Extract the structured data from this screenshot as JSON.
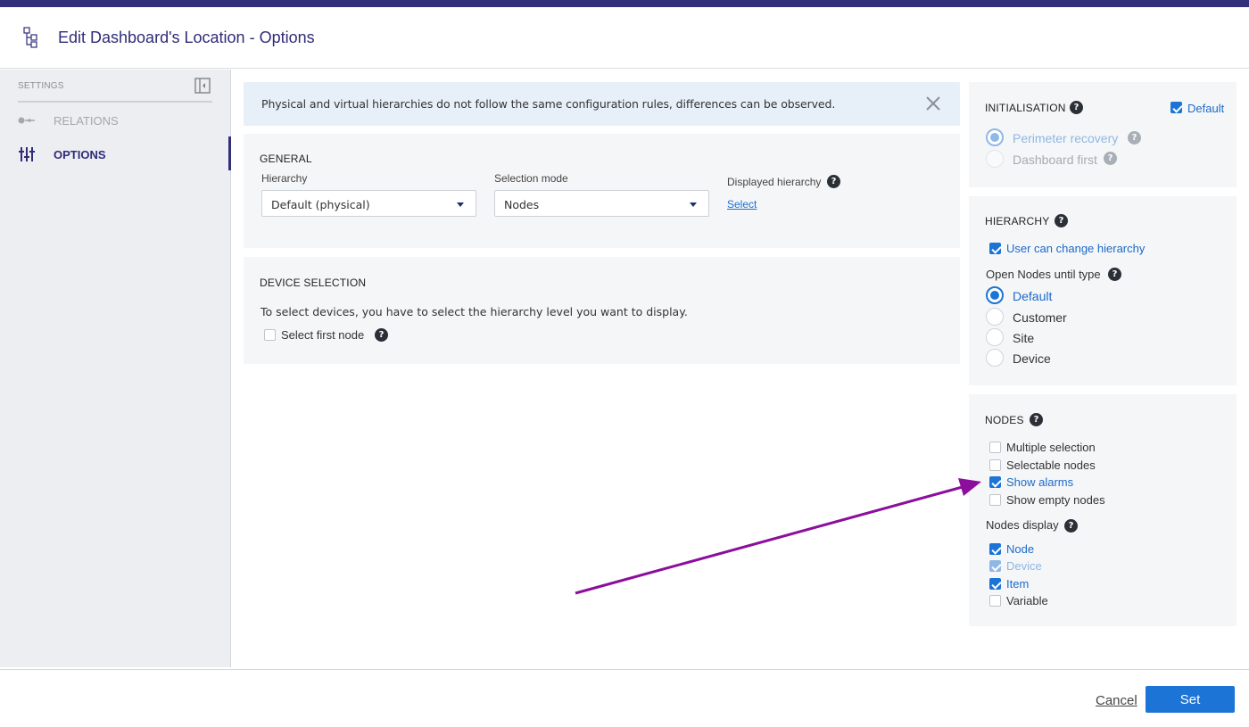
{
  "header": {
    "title": "Edit Dashboard's Location - Options",
    "icon": "hierarchy-tree-icon"
  },
  "sidebar": {
    "section_label": "SETTINGS",
    "items": [
      {
        "label": "RELATIONS",
        "icon": "relations-icon",
        "active": false
      },
      {
        "label": "OPTIONS",
        "icon": "sliders-icon",
        "active": true
      }
    ]
  },
  "notice": {
    "text": "Physical and virtual hierarchies do not follow the same configuration rules, differences can be observed."
  },
  "general": {
    "title": "GENERAL",
    "hierarchy_label": "Hierarchy",
    "hierarchy_value": "Default (physical)",
    "selection_mode_label": "Selection mode",
    "selection_mode_value": "Nodes",
    "displayed_hierarchy_label": "Displayed hierarchy",
    "select_link": "Select"
  },
  "device_selection": {
    "title": "DEVICE SELECTION",
    "description": "To select devices, you have to select the hierarchy level you want to display.",
    "select_first_node_label": "Select first node",
    "select_first_node_checked": false
  },
  "initialisation": {
    "title": "INITIALISATION",
    "default_label": "Default",
    "default_checked": true,
    "options": [
      {
        "label": "Perimeter recovery",
        "selected": true
      },
      {
        "label": "Dashboard first",
        "selected": false
      }
    ]
  },
  "hierarchy_panel": {
    "title": "HIERARCHY",
    "user_can_change_label": "User can change hierarchy",
    "user_can_change_checked": true,
    "open_nodes_label": "Open Nodes until type",
    "options": [
      {
        "label": "Default",
        "selected": true
      },
      {
        "label": "Customer",
        "selected": false
      },
      {
        "label": "Site",
        "selected": false
      },
      {
        "label": "Device",
        "selected": false
      }
    ]
  },
  "nodes_panel": {
    "title": "NODES",
    "checkboxes": [
      {
        "label": "Multiple selection",
        "checked": false
      },
      {
        "label": "Selectable nodes",
        "checked": false
      },
      {
        "label": "Show alarms",
        "checked": true
      },
      {
        "label": "Show empty nodes",
        "checked": false
      }
    ],
    "nodes_display_label": "Nodes display",
    "display_options": [
      {
        "label": "Node",
        "checked": true
      },
      {
        "label": "Device",
        "checked": true,
        "disabled": true
      },
      {
        "label": "Item",
        "checked": true
      },
      {
        "label": "Variable",
        "checked": false
      }
    ]
  },
  "footer": {
    "cancel_label": "Cancel",
    "set_label": "Set"
  },
  "colors": {
    "brand": "#33307a",
    "accent": "#1b74d6",
    "annotation_arrow": "#8b0e9c"
  }
}
